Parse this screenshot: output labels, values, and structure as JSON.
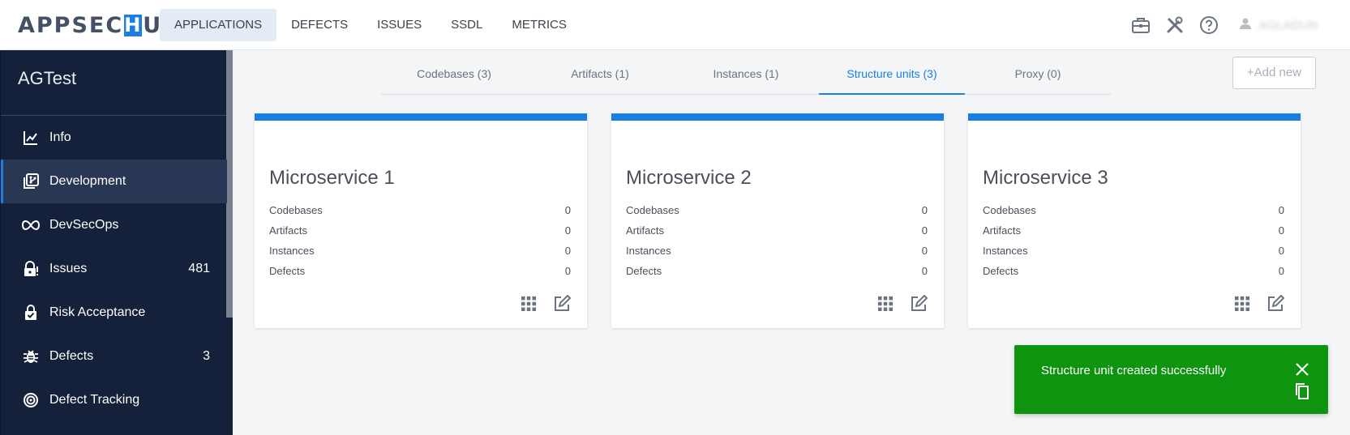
{
  "logo": {
    "part1": "APPSEC",
    "h": "H",
    "part2": "UB"
  },
  "topnav": [
    {
      "label": "APPLICATIONS",
      "active": true
    },
    {
      "label": "DEFECTS"
    },
    {
      "label": "ISSUES"
    },
    {
      "label": "SSDL"
    },
    {
      "label": "METRICS"
    }
  ],
  "header_icons": [
    "briefcase-icon",
    "tools-icon",
    "help-icon",
    "user-icon"
  ],
  "user": {
    "name": "AGLADUN"
  },
  "sidebar": {
    "project": "AGTest",
    "items": [
      {
        "label": "Info",
        "icon": "chart-line-icon"
      },
      {
        "label": "Development",
        "icon": "code-branch-icon",
        "active": true
      },
      {
        "label": "DevSecOps",
        "icon": "infinity-icon"
      },
      {
        "label": "Issues",
        "icon": "lock-alert-icon",
        "count": "481"
      },
      {
        "label": "Risk Acceptance",
        "icon": "shield-check-icon"
      },
      {
        "label": "Defects",
        "icon": "bug-icon",
        "count": "3"
      },
      {
        "label": "Defect Tracking",
        "icon": "target-icon"
      }
    ]
  },
  "tabs": [
    {
      "label": "Codebases (3)"
    },
    {
      "label": "Artifacts (1)"
    },
    {
      "label": "Instances (1)"
    },
    {
      "label": "Structure units (3)",
      "active": true
    },
    {
      "label": "Proxy (0)"
    }
  ],
  "add_new_label": "+Add new",
  "cards": [
    {
      "title": "Microservice 1",
      "stats": [
        {
          "label": "Codebases",
          "value": "0"
        },
        {
          "label": "Artifacts",
          "value": "0"
        },
        {
          "label": "Instances",
          "value": "0"
        },
        {
          "label": "Defects",
          "value": "0"
        }
      ]
    },
    {
      "title": "Microservice 2",
      "stats": [
        {
          "label": "Codebases",
          "value": "0"
        },
        {
          "label": "Artifacts",
          "value": "0"
        },
        {
          "label": "Instances",
          "value": "0"
        },
        {
          "label": "Defects",
          "value": "0"
        }
      ]
    },
    {
      "title": "Microservice 3",
      "stats": [
        {
          "label": "Codebases",
          "value": "0"
        },
        {
          "label": "Artifacts",
          "value": "0"
        },
        {
          "label": "Instances",
          "value": "0"
        },
        {
          "label": "Defects",
          "value": "0"
        }
      ]
    }
  ],
  "toast": {
    "message": "Structure unit created successfully",
    "color": "#0f9410"
  },
  "colors": {
    "accent": "#1a7fe0",
    "sidebar_bg": "#15203a",
    "success": "#0f9410"
  }
}
